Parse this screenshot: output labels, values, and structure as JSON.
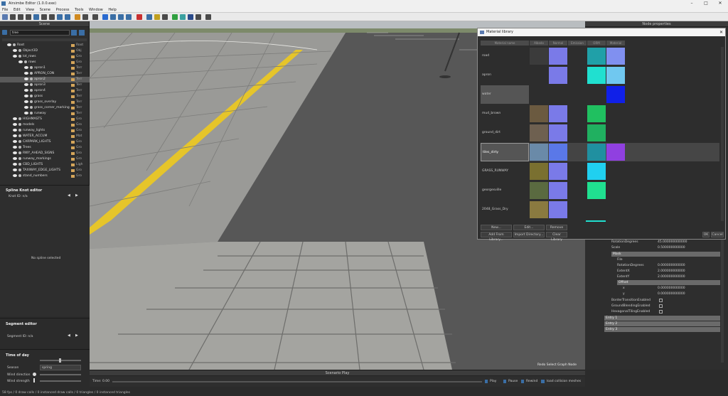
{
  "window": {
    "title": "Airsimbe Editor (1.0.0.exe)"
  },
  "menu": [
    "File",
    "Edit",
    "View",
    "Scene",
    "Process",
    "Tools",
    "Window",
    "Help"
  ],
  "scene_panel": {
    "title": "Scene",
    "search_value": "tree",
    "tree": [
      {
        "label": "Root",
        "type": "Root"
      },
      {
        "label": "Object3D",
        "type": "Obj"
      },
      {
        "label": "lot_rows",
        "type": "Gro"
      },
      {
        "label": "rows",
        "type": "Gro"
      },
      {
        "label": "apron1",
        "type": "Terr"
      },
      {
        "label": "APRON_CON",
        "type": "Terr"
      },
      {
        "label": "apron2",
        "type": "Terr"
      },
      {
        "label": "apron3",
        "type": "Terr"
      },
      {
        "label": "apron4",
        "type": "Terr"
      },
      {
        "label": "grass",
        "type": "Terr"
      },
      {
        "label": "grass_overlay",
        "type": "Terr"
      },
      {
        "label": "grass_corner_marking",
        "type": "Terr"
      },
      {
        "label": "runway",
        "type": "Terr"
      },
      {
        "label": "HIGHMASTS",
        "type": "Gro"
      },
      {
        "label": "models",
        "type": "Gro"
      },
      {
        "label": "runway_lights",
        "type": "Gro"
      },
      {
        "label": "WATER_ACCUM",
        "type": "Mat"
      },
      {
        "label": "CARPARK_LIGHTS",
        "type": "Gro"
      },
      {
        "label": "Trees",
        "type": "Gro"
      },
      {
        "label": "RWY_AHEAD_SIGNS",
        "type": "Gro"
      },
      {
        "label": "runway_markings",
        "type": "Gro"
      },
      {
        "label": "CBD_LIGHTS",
        "type": "Ligh"
      },
      {
        "label": "TAXIWAY_EDGE_LIGHTS",
        "type": "Gro"
      },
      {
        "label": "stand_numbers",
        "type": "Gro"
      }
    ]
  },
  "spline_editor": {
    "title": "Spline Knot editor",
    "knot_id": "Knot ID: n/a",
    "empty": "No spline selected"
  },
  "segment_editor": {
    "title": "Segment editor",
    "segment_id": "Segment ID: n/a"
  },
  "time_of_day": {
    "title": "Time of day",
    "season_label": "Season",
    "season_value": "spring",
    "wind_dir_label": "Wind direction",
    "wind_str_label": "Wind strength"
  },
  "viewport": {
    "overlay": "Redo Select Graph Node"
  },
  "scenario": {
    "title": "Scenario Play",
    "time": "Time: 0.00",
    "play": "Play",
    "pause": "Pause",
    "rewind": "Rewind",
    "load": "load collision meshes"
  },
  "status": "58 fps / 0 draw calls / 0 instanced draw calls / 0 triangles / 0 instanced triangles",
  "node_properties": {
    "title": "Node properties",
    "rows": [
      {
        "label": "RotationDegrees",
        "value": "45.000000000000"
      },
      {
        "label": "Scale",
        "value": "0.500000000000"
      }
    ],
    "mask_group": "Mask",
    "mask_rows": [
      {
        "label": "File",
        "value": ""
      },
      {
        "label": "RotationDegrees",
        "value": "0.000000000000"
      },
      {
        "label": "ExtentX",
        "value": "2.000000000000"
      },
      {
        "label": "ExtentY",
        "value": "2.000000000000"
      }
    ],
    "offset_group": "Offset",
    "offset_rows": [
      {
        "label": "x",
        "value": "0.000000000000"
      },
      {
        "label": "y",
        "value": "0.000000000000"
      }
    ],
    "checks": [
      "BorderTransitionEnabled",
      "GroundBlendingEnabled",
      "HexagonalTilingEnabled"
    ],
    "entries": [
      "Entry 1",
      "Entry 2",
      "Entry 3"
    ]
  },
  "material_library": {
    "title": "Material library",
    "headers": [
      "Material name",
      "Albedo",
      "Normal",
      "Emission",
      "ORM",
      "Material"
    ],
    "rows": [
      {
        "name": "road",
        "colors": [
          "#3b3b3b",
          "#7a7ae8",
          "",
          "#20a0a8",
          "#8090f0"
        ]
      },
      {
        "name": "apron",
        "colors": [
          "",
          "#7a7ae8",
          "",
          "#20e0d0",
          "#70c8f0"
        ]
      },
      {
        "name": "water",
        "colors": [
          "",
          "",
          "",
          "",
          "#1020e8"
        ]
      },
      {
        "name": "mud_brown",
        "colors": [
          "#6b5a40",
          "#7a7ae8",
          "",
          "#20c060",
          ""
        ]
      },
      {
        "name": "ground_dirt",
        "colors": [
          "#6e6050",
          "#7a7ae8",
          "",
          "#20b060",
          ""
        ]
      },
      {
        "name": "tiles_dirty",
        "colors": [
          "#6a8aa8",
          "#5a78e8",
          "#444444",
          "#2090a0",
          "#9040e0"
        ]
      },
      {
        "name": "GRASS_RUNWAY",
        "colors": [
          "#7a7030",
          "#7a7ae8",
          "",
          "#20d0f0",
          ""
        ]
      },
      {
        "name": "georgesville",
        "colors": [
          "#5a6a40",
          "#7a7ae8",
          "",
          "#20e090",
          ""
        ]
      },
      {
        "name": "2048_Grass_Dry",
        "colors": [
          "#8a7a40",
          "#7a7ae8",
          "",
          "",
          ""
        ]
      }
    ],
    "buttons": {
      "new": "New...",
      "edit": "Edit...",
      "remove": "Remove",
      "add_from": "Add From Library...",
      "import_dir": "Import Directory...",
      "clear": "Clear Library",
      "ok": "OK",
      "cancel": "Cancel"
    }
  }
}
